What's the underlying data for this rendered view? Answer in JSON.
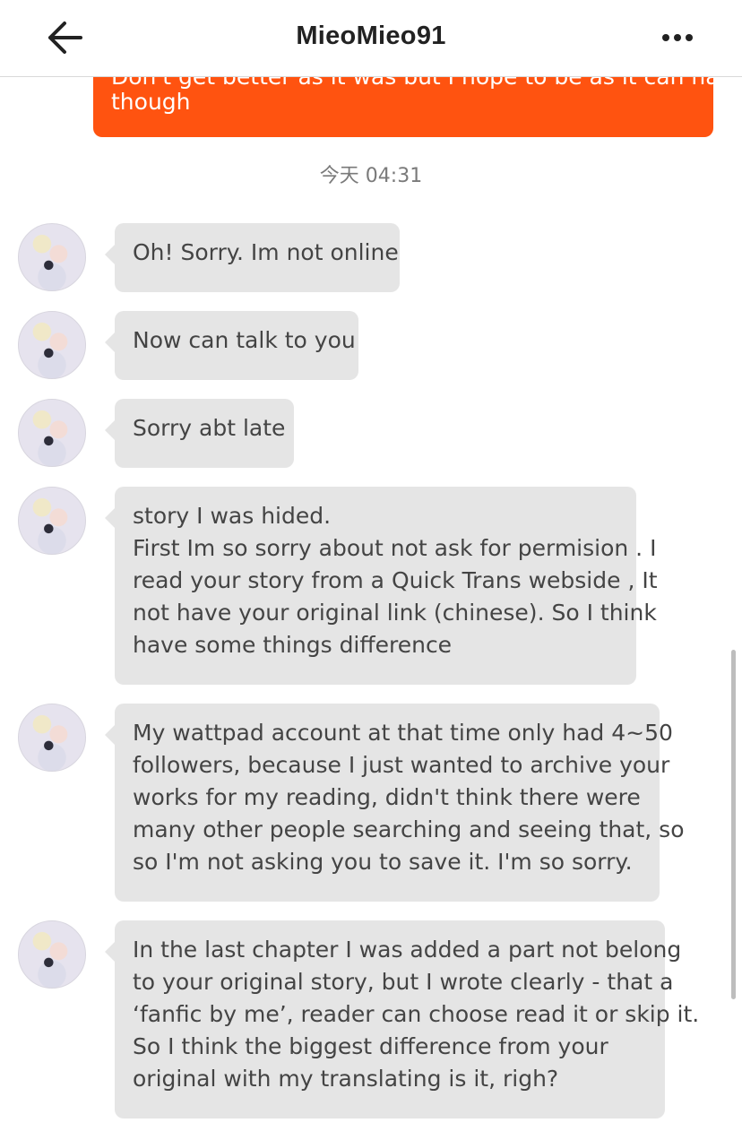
{
  "header": {
    "title": "MieoMieo91"
  },
  "outgoing": {
    "partial_line": "Don't get better as it was but I hope to be as it can have",
    "last_line": "though"
  },
  "timestamp": "今天 04:31",
  "messages": [
    {
      "lines": [
        "Oh! Sorry. Im not online"
      ]
    },
    {
      "lines": [
        "Now can talk to you"
      ]
    },
    {
      "lines": [
        "Sorry abt late"
      ]
    },
    {
      "lines": [
        "story I was hided.",
        "First Im so sorry about not ask for permision . I",
        "read your story from a Quick Trans webside , It",
        "not have your original link (chinese). So I think",
        "have some things difference"
      ]
    },
    {
      "lines": [
        "My wattpad account at that time only had 4~50",
        "followers, because I just wanted to archive your",
        "works for my reading, didn't think there were",
        "many other people searching and seeing that, so",
        "so  I'm not asking you to save it.  I'm so sorry."
      ]
    },
    {
      "lines": [
        "In the last chapter I was added a part not belong",
        "to your original story, but I wrote clearly - that a",
        "‘fanfic by me’, reader can choose read it or skip it.",
        "So I think the biggest difference from your",
        "original with my translating is it, righ?"
      ]
    }
  ]
}
